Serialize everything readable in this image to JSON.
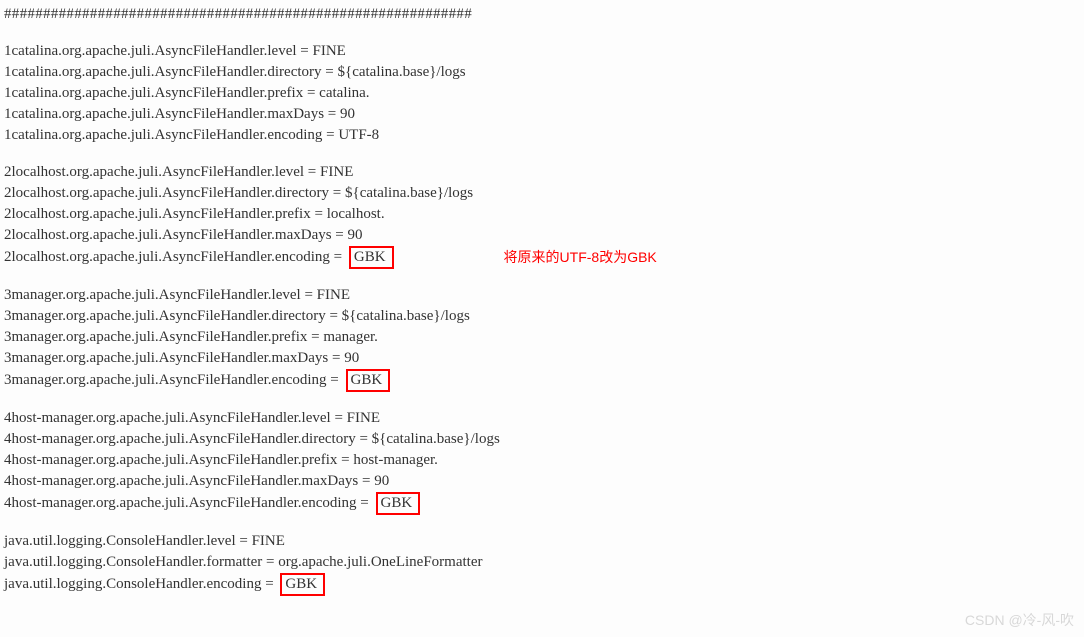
{
  "separator": "############################################################",
  "annotation": "将原来的UTF-8改为GBK",
  "watermark": "CSDN @冷-风-吹",
  "blocks": [
    {
      "prefix": "1catalina",
      "lines": [
        {
          "prop": "level",
          "value": "FINE",
          "boxed": false
        },
        {
          "prop": "directory",
          "value": "${catalina.base}/logs",
          "boxed": false
        },
        {
          "prop": "prefix",
          "value": "catalina.",
          "boxed": false
        },
        {
          "prop": "maxDays",
          "value": "90",
          "boxed": false
        },
        {
          "prop": "encoding",
          "value": "UTF-8",
          "boxed": false
        }
      ],
      "note": false
    },
    {
      "prefix": "2localhost",
      "lines": [
        {
          "prop": "level",
          "value": "FINE",
          "boxed": false
        },
        {
          "prop": "directory",
          "value": "${catalina.base}/logs",
          "boxed": false
        },
        {
          "prop": "prefix",
          "value": "localhost.",
          "boxed": false
        },
        {
          "prop": "maxDays",
          "value": "90",
          "boxed": false
        },
        {
          "prop": "encoding",
          "value": "GBK",
          "boxed": true
        }
      ],
      "note": true
    },
    {
      "prefix": "3manager",
      "lines": [
        {
          "prop": "level",
          "value": "FINE",
          "boxed": false
        },
        {
          "prop": "directory",
          "value": "${catalina.base}/logs",
          "boxed": false
        },
        {
          "prop": "prefix",
          "value": "manager.",
          "boxed": false
        },
        {
          "prop": "maxDays",
          "value": "90",
          "boxed": false
        },
        {
          "prop": "encoding",
          "value": "GBK",
          "boxed": true
        }
      ],
      "note": false
    },
    {
      "prefix": "4host-manager",
      "lines": [
        {
          "prop": "level",
          "value": "FINE",
          "boxed": false
        },
        {
          "prop": "directory",
          "value": "${catalina.base}/logs",
          "boxed": false
        },
        {
          "prop": "prefix",
          "value": "host-manager.",
          "boxed": false
        },
        {
          "prop": "maxDays",
          "value": "90",
          "boxed": false
        },
        {
          "prop": "encoding",
          "value": "GBK",
          "boxed": true
        }
      ],
      "note": false
    }
  ],
  "console_block": {
    "clazz": "java.util.logging.ConsoleHandler",
    "lines": [
      {
        "prop": "level",
        "value": "FINE",
        "boxed": false
      },
      {
        "prop": "formatter",
        "value": "org.apache.juli.OneLineFormatter",
        "boxed": false
      },
      {
        "prop": "encoding",
        "value": "GBK",
        "boxed": true
      }
    ]
  },
  "file_handler_class": "org.apache.juli.AsyncFileHandler"
}
